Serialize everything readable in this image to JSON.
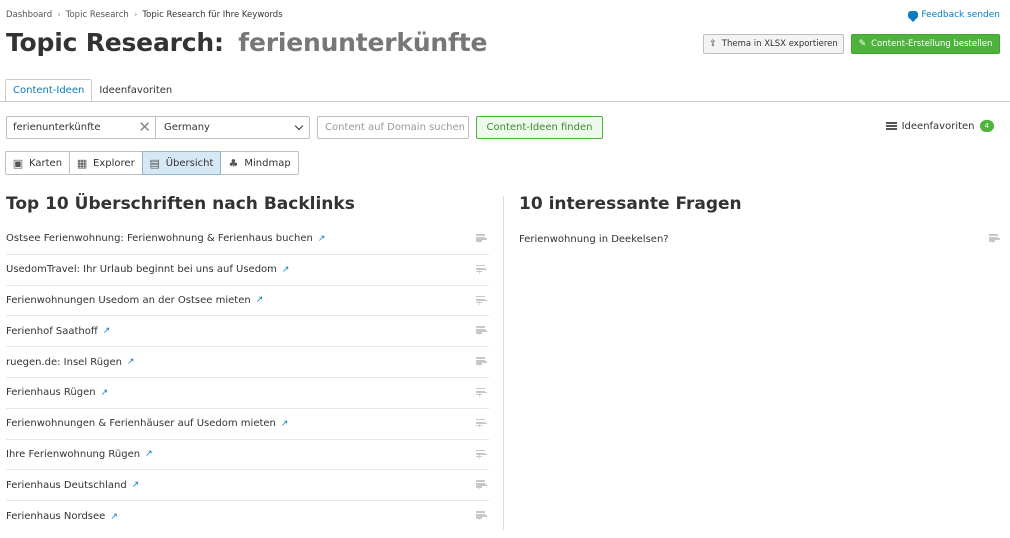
{
  "breadcrumb": [
    "Dashboard",
    "Topic Research",
    "Topic Research für Ihre Keywords"
  ],
  "feedback_label": "Feedback senden",
  "title": {
    "prefix": "Topic Research:",
    "keyword": "ferienunterkünfte"
  },
  "actions": {
    "export_label": "Thema in XLSX exportieren",
    "order_label": "Content-Erstellung bestellen"
  },
  "tabs": [
    {
      "label": "Content-Ideen",
      "active": true
    },
    {
      "label": "Ideenfavoriten",
      "active": false
    }
  ],
  "search": {
    "keyword_value": "ferienunterkünfte",
    "country_value": "Germany",
    "domain_placeholder": "Content auf Domain suchen",
    "find_label": "Content-Ideen finden"
  },
  "favorites": {
    "label": "Ideenfavoriten",
    "count": "4"
  },
  "views": [
    {
      "label": "Karten",
      "icon": "cards-icon",
      "active": false
    },
    {
      "label": "Explorer",
      "icon": "table-icon",
      "active": false
    },
    {
      "label": "Übersicht",
      "icon": "overview-icon",
      "active": true
    },
    {
      "label": "Mindmap",
      "icon": "mindmap-icon",
      "active": false
    }
  ],
  "left_section": {
    "heading": "Top 10 Überschriften nach Backlinks",
    "items": [
      "Ostsee Ferienwohnung: Ferienwohnung & Ferienhaus buchen",
      "UsedomTravel: Ihr Urlaub beginnt bei uns auf Usedom",
      "Ferienwohnungen Usedom an der Ostsee mieten",
      "Ferienhof Saathoff",
      "ruegen.de: Insel Rügen",
      "Ferienhaus Rügen",
      "Ferienwohnungen & Ferienhäuser auf Usedom mieten",
      "Ihre Ferienwohnung Rügen",
      "Ferienhaus Deutschland",
      "Ferienhaus Nordsee"
    ]
  },
  "right_section": {
    "heading": "10 interessante Fragen",
    "items": [
      "Ferienwohnung in Deekelsen?"
    ]
  },
  "colors": {
    "accent_blue": "#0a7cc1",
    "accent_green": "#4db33d"
  }
}
